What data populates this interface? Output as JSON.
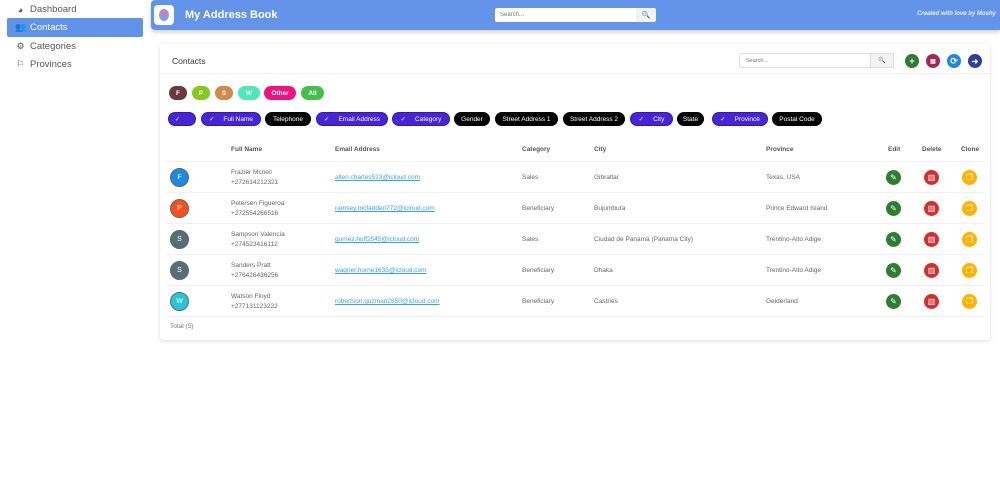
{
  "sidebar": {
    "items": [
      {
        "label": "Dashboard",
        "icon": "dashboard-icon"
      },
      {
        "label": "Contacts",
        "icon": "users-icon",
        "active": true
      },
      {
        "label": "Categories",
        "icon": "cogs-icon"
      },
      {
        "label": "Provinces",
        "icon": "flag-icon"
      }
    ]
  },
  "header": {
    "title": "My Address Book",
    "search_placeholder": "Search...",
    "credit": "Created with love by Moshy"
  },
  "card": {
    "title": "Contacts",
    "search_placeholder": "Search...",
    "total": "Total (5)"
  },
  "letter_filters": [
    {
      "label": "F",
      "color": "#6b3a3e"
    },
    {
      "label": "P",
      "color": "#84c91c"
    },
    {
      "label": "S",
      "color": "#d08a4c"
    },
    {
      "label": "W",
      "color": "#4de8b9"
    },
    {
      "label": "Other",
      "color": "#f0137f"
    },
    {
      "label": "All",
      "color": "#44c04a"
    }
  ],
  "column_toggles": [
    {
      "label": "",
      "on": true
    },
    {
      "label": "Full Name",
      "on": true
    },
    {
      "label": "Telephone",
      "on": false
    },
    {
      "label": "Email Address",
      "on": true
    },
    {
      "label": "Category",
      "on": true
    },
    {
      "label": "Gender",
      "on": false
    },
    {
      "label": "Street Address 1",
      "on": false
    },
    {
      "label": "Street Address 2",
      "on": false
    },
    {
      "label": "City",
      "on": true
    },
    {
      "label": "State",
      "on": false
    },
    {
      "label": "Province",
      "on": true
    },
    {
      "label": "Postal Code",
      "on": false
    }
  ],
  "table": {
    "headers": [
      "Full Name",
      "Email Address",
      "Category",
      "City",
      "Province",
      "Edit",
      "Delete",
      "Clone"
    ],
    "rows": [
      {
        "initial": "F",
        "avatar_color": "#1e88e5",
        "name": "Frazier Mcneil",
        "phone": "+272614212321",
        "email": "allen.charles523@icloud.com",
        "category": "Sales",
        "city": "Gibraltar",
        "province": "Texas, USA"
      },
      {
        "initial": "P",
        "avatar_color": "#f4511e",
        "name": "Petersen Figueroa",
        "phone": "+272554266516",
        "email": "ramsey.mcfadden772@icloud.com",
        "category": "Beneficiary",
        "city": "Bujumbura",
        "province": "Prince Edward Island"
      },
      {
        "initial": "S",
        "avatar_color": "#546e7a",
        "name": "Sampson Valencia",
        "phone": "+274523416112",
        "email": "gomez.huff2545@icloud.com",
        "category": "Sales",
        "city": "Ciudad de Panamá (Panama City)",
        "province": "Trentino-Alto Adige"
      },
      {
        "initial": "S",
        "avatar_color": "#546e7a",
        "name": "Sanders Pratt",
        "phone": "+276426436256",
        "email": "wagner.horne1635@icloud.com",
        "category": "Beneficiary",
        "city": "Dhaka",
        "province": "Trentino-Alto Adige"
      },
      {
        "initial": "W",
        "avatar_color": "#26c6da",
        "name": "Watson Floyd",
        "phone": "+277131123222",
        "email": "robertson.guzman2850@icloud.com",
        "category": "Beneficiary",
        "city": "Castries",
        "province": "Gelderland"
      }
    ]
  }
}
